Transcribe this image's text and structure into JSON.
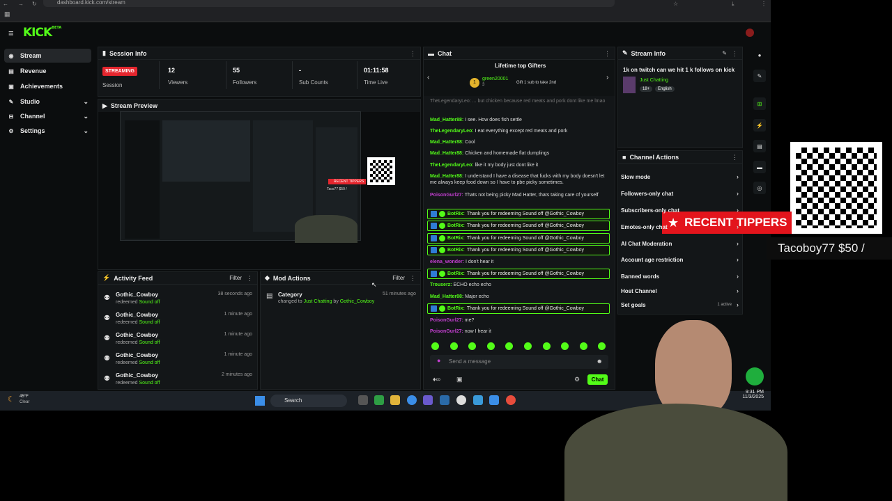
{
  "browser": {
    "url": "dashboard.kick.com/stream"
  },
  "brand": {
    "logo": "KICK",
    "beta": "BETA",
    "accent": "#53fc18"
  },
  "sidebar": {
    "items": [
      {
        "label": "Stream",
        "icon": "broadcast-icon"
      },
      {
        "label": "Revenue",
        "icon": "dollar-icon"
      },
      {
        "label": "Achievements",
        "icon": "trophy-icon"
      },
      {
        "label": "Studio",
        "icon": "studio-icon"
      },
      {
        "label": "Channel",
        "icon": "channel-icon"
      },
      {
        "label": "Settings",
        "icon": "gear-icon"
      }
    ]
  },
  "session": {
    "title": "Session Info",
    "status": "STREAMING",
    "status_label": "Session",
    "stats": [
      {
        "value": "12",
        "label": "Viewers"
      },
      {
        "value": "55",
        "label": "Followers"
      },
      {
        "value": "-",
        "label": "Sub Counts"
      },
      {
        "value": "01:11:58",
        "label": "Time Live"
      }
    ]
  },
  "preview": {
    "title": "Stream Preview",
    "overlay_label": "RECENT TIPPERS",
    "overlay_tip": "Taco77 $50 /"
  },
  "activity": {
    "title": "Activity Feed",
    "filter": "Filter",
    "rows": [
      {
        "name": "Gothic_Cowboy",
        "verb": "redeemed",
        "item": "Sound off",
        "time": "38 seconds ago"
      },
      {
        "name": "Gothic_Cowboy",
        "verb": "redeemed",
        "item": "Sound off",
        "time": "1 minute ago"
      },
      {
        "name": "Gothic_Cowboy",
        "verb": "redeemed",
        "item": "Sound off",
        "time": "1 minute ago"
      },
      {
        "name": "Gothic_Cowboy",
        "verb": "redeemed",
        "item": "Sound off",
        "time": "1 minute ago"
      },
      {
        "name": "Gothic_Cowboy",
        "verb": "redeemed",
        "item": "Sound off",
        "time": "2 minutes ago"
      }
    ]
  },
  "mod": {
    "title": "Mod Actions",
    "filter": "Filter",
    "row": {
      "title": "Category",
      "text1": "changed to",
      "cat": "Just Chatting",
      "by": "by",
      "user": "Gothic_Cowboy",
      "time": "51 minutes ago"
    }
  },
  "chat": {
    "title": "Chat",
    "gifters_title": "Lifetime top Gifters",
    "top_gifter": "green20001",
    "top_gifter_count": "3",
    "gift_hint": "Gift 1 sub to take 2nd",
    "truncated_top": "TheLegendaryLeo: ... but chicken because red meats and pork dont like me lmao",
    "messages": [
      {
        "user": "Mad_Hatter88",
        "color": "#53fc18",
        "text": "I see. How does fish settle"
      },
      {
        "user": "TheLegendaryLeo",
        "color": "#53fc18",
        "text": "I eat everything except red meats and pork"
      },
      {
        "user": "Mad_Hatter88",
        "color": "#53fc18",
        "text": "Cool"
      },
      {
        "user": "Mad_Hatter88",
        "color": "#53fc18",
        "text": "Chicken and homemade flat dumplings"
      },
      {
        "user": "TheLegendaryLeo",
        "color": "#53fc18",
        "text": "like it my body just dont like it"
      },
      {
        "user": "Mad_Hatter88",
        "color": "#53fc18",
        "text": "I understand I have a disease that fucks with my body doesn't let me always keep food down so I have to pbe picky sometimes."
      },
      {
        "user": "PoisonGurl27",
        "color": "#c43fd1",
        "text": "Thats not being picky Mad Hatter, thats taking care of yourself"
      }
    ],
    "bot_user": "BotRix",
    "bot_text": "Thank you for redeeming Sound off @Gothic_Cowboy",
    "messages2": [
      {
        "user": "elena_wonder",
        "color": "#c43fd1",
        "text": "I don't hear it"
      },
      {
        "user": "Trouserz",
        "color": "#53fc18",
        "text": "ECHO echo echo"
      },
      {
        "user": "Mad_Hatter88",
        "color": "#53fc18",
        "text": "Major echo"
      }
    ],
    "messages3": [
      {
        "user": "PoisonGurl27",
        "color": "#c43fd1",
        "text": "me?"
      },
      {
        "user": "PoisonGurl27",
        "color": "#c43fd1",
        "text": "now I hear it"
      }
    ],
    "input_placeholder": "Send a message",
    "send_label": "Chat"
  },
  "stream_info": {
    "title": "Stream Info",
    "stream_title": "1k on twitch can we hit 1 k follows on kick",
    "category": "Just Chatting",
    "tags": [
      "18+",
      "English"
    ]
  },
  "channel_actions": {
    "title": "Channel Actions",
    "items": [
      {
        "label": "Slow mode"
      },
      {
        "label": "Followers-only chat"
      },
      {
        "label": "Subscribers-only chat"
      },
      {
        "label": "Emotes-only chat"
      },
      {
        "label": "AI Chat Moderation"
      },
      {
        "label": "Account age restriction"
      },
      {
        "label": "Banned words"
      },
      {
        "label": "Host Channel"
      },
      {
        "label": "Set goals",
        "extra": "1 active"
      }
    ]
  },
  "overlay": {
    "title": "RECENT TIPPERS",
    "tipper": "Tacoboy77 $50 /"
  },
  "taskbar": {
    "temp": "45°F",
    "weather": "Clear",
    "search": "Search",
    "time": "9:31 PM",
    "date": "11/3/2025"
  }
}
